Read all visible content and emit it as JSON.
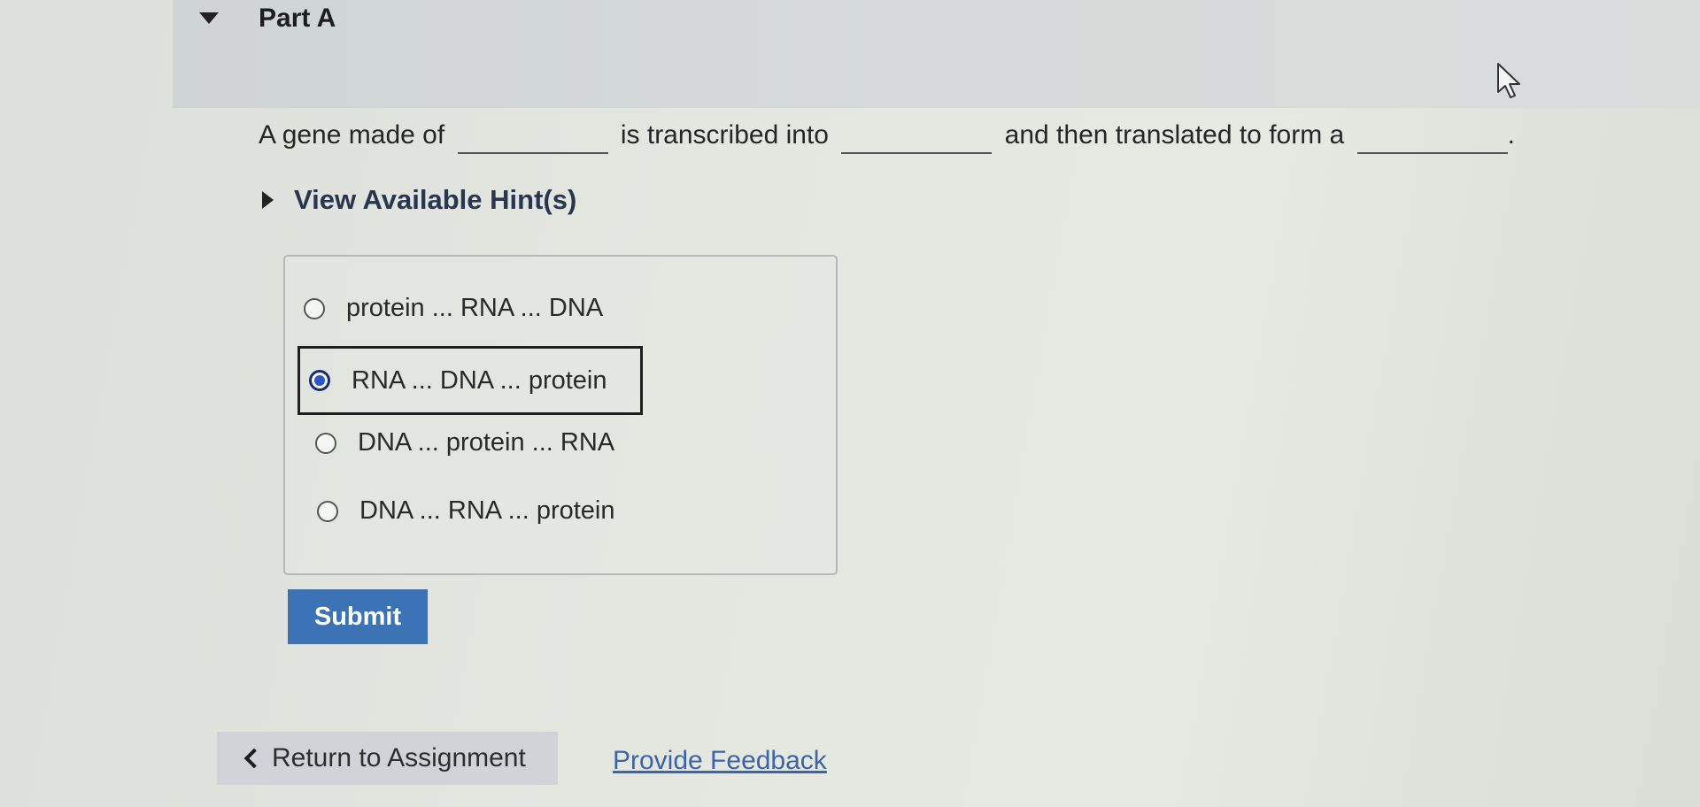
{
  "part": {
    "title": "Part A"
  },
  "question": {
    "segment1": "A gene made of",
    "segment2": "is transcribed into",
    "segment3": "and then translated to form a",
    "end": "."
  },
  "hint": {
    "label": "View Available Hint(s)"
  },
  "options": [
    {
      "label": "protein ... RNA ... DNA",
      "selected": false
    },
    {
      "label": "RNA ... DNA ... protein",
      "selected": true
    },
    {
      "label": "DNA ... protein ... RNA",
      "selected": false
    },
    {
      "label": "DNA ... RNA ... protein",
      "selected": false
    }
  ],
  "submit": {
    "label": "Submit"
  },
  "footer": {
    "return_label": "Return to Assignment",
    "feedback_label": "Provide Feedback"
  },
  "colors": {
    "accent": "#3b73b5",
    "link": "#3d63a8",
    "selected_radio": "#2d55c9"
  }
}
